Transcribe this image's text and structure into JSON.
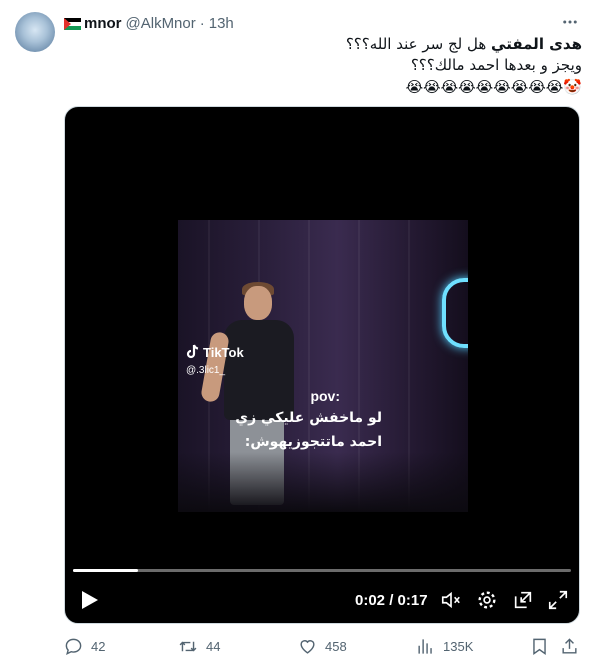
{
  "header": {
    "display_name": "mnor",
    "handle": "@AlkMnor",
    "separator": "·",
    "time": "13h"
  },
  "tweet": {
    "line1_bold": "هدى المفتي",
    "line1_rest": " هل لج سر عند الله؟؟؟",
    "line2": "ويجز و بعدها احمد مالك؟؟؟",
    "emojis": "🤡😭😭😭😭😭😭😭😭😭"
  },
  "video": {
    "tiktok_label": "TikTok",
    "tiktok_user": "@.3lic1_",
    "caption_pov": "pov:",
    "caption_line1": "لو ماخفش عليكي زي",
    "caption_line2": "احمد ماتتجوزيهوش:",
    "current_time": "0:02",
    "separator": " / ",
    "duration": "0:17",
    "progress_fraction": 0.13
  },
  "actions": {
    "replies": "42",
    "retweets": "44",
    "likes": "458",
    "views": "135K"
  },
  "icons": {
    "more": "more-icon",
    "reply": "reply-icon",
    "retweet": "retweet-icon",
    "like": "heart-icon",
    "views": "views-icon",
    "bookmark": "bookmark-icon",
    "share": "share-icon"
  },
  "colors": {
    "secondary_text": "#536471",
    "media_bg": "#000000",
    "neon": "#6fe0ff"
  }
}
